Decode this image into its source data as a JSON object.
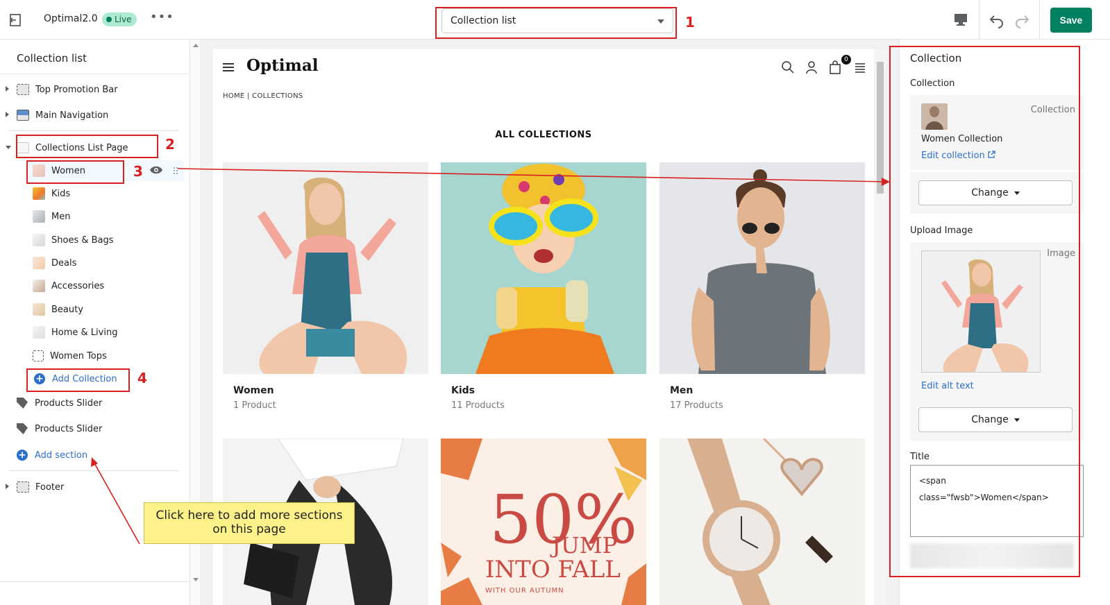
{
  "topbar": {
    "theme_name": "Optimal2.0",
    "live_badge": "Live",
    "more": "•••",
    "template_select": "Collection list",
    "save": "Save"
  },
  "sidebar": {
    "title": "Collection list",
    "sections": {
      "top_promo": "Top Promotion Bar",
      "main_nav": "Main Navigation",
      "collections_page": "Collections List Page",
      "blocks": [
        "Women",
        "Kids",
        "Men",
        "Shoes & Bags",
        "Deals",
        "Accessories",
        "Beauty",
        "Home & Living",
        "Women Tops"
      ],
      "add_collection": "Add Collection",
      "slider1": "Products Slider",
      "slider2": "Products Slider",
      "add_section": "Add section",
      "footer": "Footer"
    }
  },
  "preview": {
    "logo": "Optimal",
    "cart_count": "0",
    "breadcrumb": "HOME  |  COLLECTIONS",
    "heading": "ALL COLLECTIONS",
    "cards": [
      {
        "name": "Women",
        "count": "1 Product"
      },
      {
        "name": "Kids",
        "count": "11 Products"
      },
      {
        "name": "Men",
        "count": "17 Products"
      }
    ],
    "promo": {
      "big": "50%",
      "l1": "JUMP",
      "l2": "INTO FALL",
      "l3": "WITH OUR AUTUMN"
    }
  },
  "rpanel": {
    "head": "Collection",
    "collection_label": "Collection",
    "collection_right": "Collection",
    "collection_name": "Women Collection",
    "edit_collection": "Edit collection",
    "change": "Change",
    "upload_label": "Upload Image",
    "image_right": "Image",
    "edit_alt": "Edit alt text",
    "change2": "Change",
    "title_label": "Title",
    "title_value_1": "<span",
    "title_value_2": "class=\"fwsb\">Women</span>"
  },
  "annotations": {
    "n1": "1",
    "n2": "2",
    "n3": "3",
    "n4": "4",
    "callout_l1": "Click here to add more sections",
    "callout_l2": "on this page"
  },
  "colors": {
    "accent": "#2c6ecb",
    "save": "#008060",
    "annotation": "#d92020",
    "callout": "#fdf18a"
  }
}
